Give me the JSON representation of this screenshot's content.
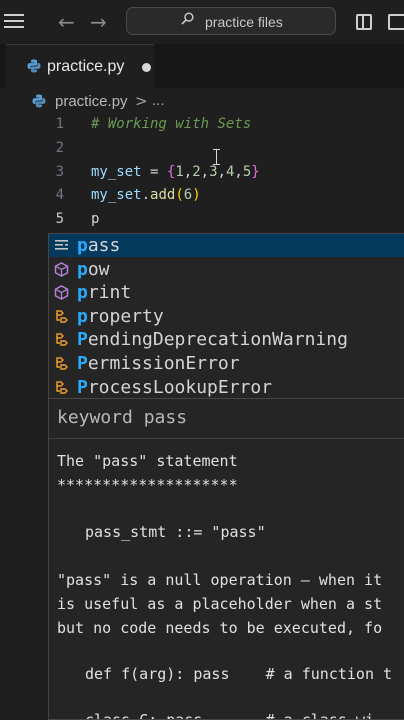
{
  "titlebar": {
    "back_arrow": "←",
    "forward_arrow": "→",
    "search_text": "practice files"
  },
  "tab": {
    "filename": "practice.py",
    "icon": "python-icon",
    "modified_indicator": "●"
  },
  "breadcrumb": {
    "file": "practice.py",
    "separator": ">",
    "ellipsis": "..."
  },
  "editor": {
    "lines": [
      {
        "num": "1",
        "code": "# Working with Sets"
      },
      {
        "num": "2",
        "code": ""
      },
      {
        "num": "3",
        "code": "my_set = {1,2,3,4,5}"
      },
      {
        "num": "4",
        "code": "my_set.add(6)"
      },
      {
        "num": "5",
        "code": "p"
      }
    ]
  },
  "suggestions": [
    {
      "match": "p",
      "rest": "ass",
      "kind": "keyword-icon"
    },
    {
      "match": "p",
      "rest": "ow",
      "kind": "method-icon"
    },
    {
      "match": "p",
      "rest": "rint",
      "kind": "method-icon"
    },
    {
      "match": "p",
      "rest": "roperty",
      "kind": "class-icon"
    },
    {
      "match": "P",
      "rest": "endingDeprecationWarning",
      "kind": "class-icon"
    },
    {
      "match": "P",
      "rest": "ermissionError",
      "kind": "class-icon"
    },
    {
      "match": "P",
      "rest": "rocessLookupError",
      "kind": "class-icon"
    }
  ],
  "details": {
    "title": "keyword pass",
    "heading": "The \"pass\" statement",
    "underline": "********************",
    "grammar": "pass_stmt ::= \"pass\"",
    "para1": "\"pass\" is a null operation — when it",
    "para2": "is useful as a placeholder when a st",
    "para3": "but no code needs to be executed, fo",
    "example1": "def f(arg): pass    # a function t",
    "example2": "class C: pass       # a class wi"
  },
  "colors": {
    "background": "#1f1f1f",
    "widget": "#252526",
    "selection": "#04395e",
    "match_highlight": "#2aaaff"
  }
}
